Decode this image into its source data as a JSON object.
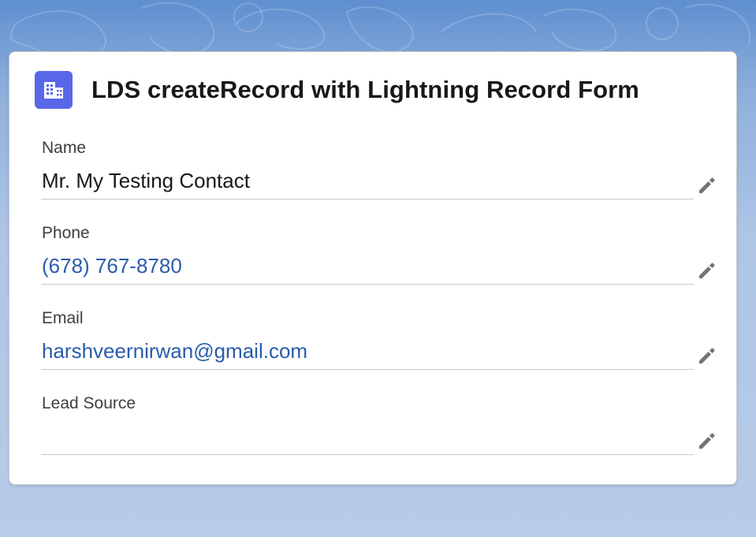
{
  "card": {
    "title": "LDS createRecord with Lightning Record Form",
    "icon": "building-icon",
    "icon_color": "#5867e8"
  },
  "fields": [
    {
      "label": "Name",
      "value": "Mr. My Testing Contact",
      "is_link": false
    },
    {
      "label": "Phone",
      "value": "(678) 767-8780",
      "is_link": true
    },
    {
      "label": "Email",
      "value": "harshveernirwan@gmail.com",
      "is_link": true
    },
    {
      "label": "Lead Source",
      "value": "",
      "is_link": false
    }
  ],
  "colors": {
    "link": "#2a5cab",
    "text": "#181818",
    "label": "#3e3e3c",
    "edit_icon": "#747474"
  }
}
